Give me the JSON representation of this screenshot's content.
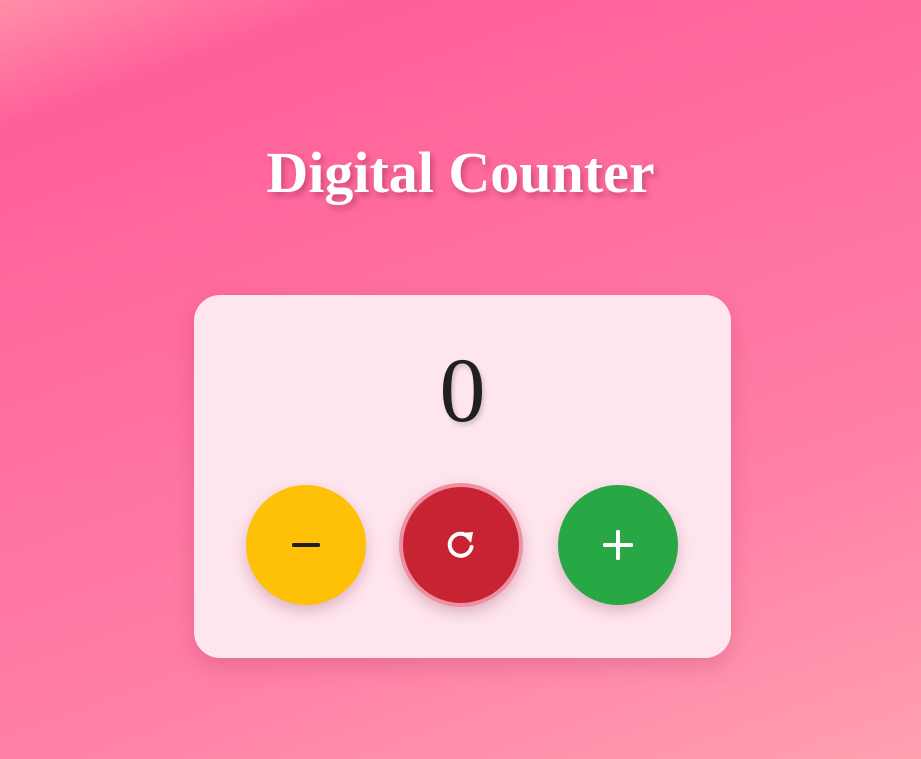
{
  "page": {
    "title": "Digital Counter"
  },
  "counter": {
    "value": "0"
  },
  "buttons": {
    "decrement": {
      "icon": "minus-icon",
      "color": "#ffc107"
    },
    "reset": {
      "icon": "redo-icon",
      "color": "#c82333"
    },
    "increment": {
      "icon": "plus-icon",
      "color": "#28a745"
    }
  },
  "theme": {
    "card_background": "#ffe5ee",
    "title_color": "#ffffff",
    "count_color": "#1f1f24"
  }
}
